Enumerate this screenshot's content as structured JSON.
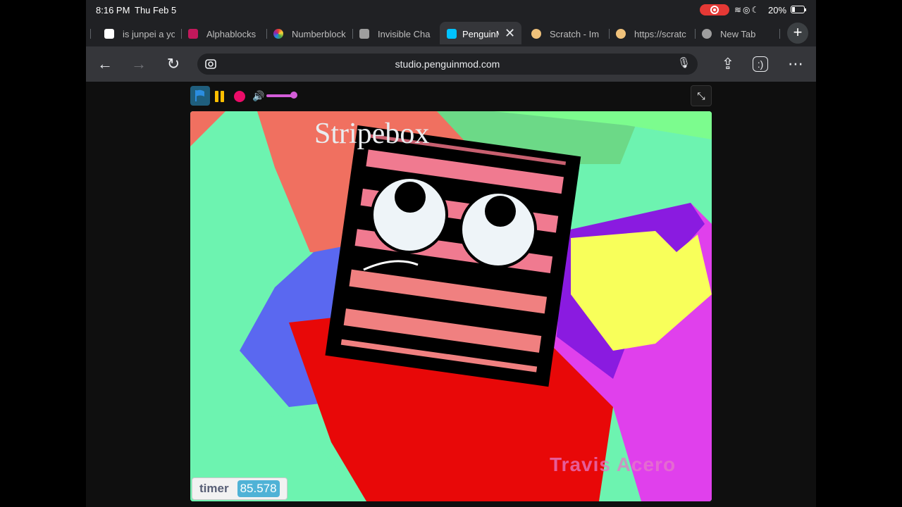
{
  "status_bar": {
    "time": "8:16 PM",
    "date": "Thu Feb 5",
    "battery": "20%"
  },
  "tabs": [
    {
      "title": "is junpei a yo",
      "favicon": "google-icon",
      "color": "#ffffff"
    },
    {
      "title": "Alphablocks",
      "favicon": "alphablocks-icon",
      "color": "#c2185b"
    },
    {
      "title": "Numberblock",
      "favicon": "numberblocks-icon",
      "color": "#7e57c2"
    },
    {
      "title": "Invisible Cha",
      "favicon": "image-icon",
      "color": "#9e9e9e"
    },
    {
      "title": "PenguinM",
      "favicon": "penguinmod-icon",
      "color": "#00c3ff",
      "active": true
    },
    {
      "title": "Scratch - Im",
      "favicon": "scratch-icon",
      "color": "#f0c27b"
    },
    {
      "title": "https://scratc",
      "favicon": "scratch-icon",
      "color": "#f0c27b"
    },
    {
      "title": "New Tab",
      "favicon": "globe-icon",
      "color": "#bdbdbd"
    }
  ],
  "toolbar": {
    "url": "studio.penguinmod.com"
  },
  "stage": {
    "title": "Stripebox",
    "timer_label": "timer",
    "timer_value": "85.578",
    "watermark": "Travis Acero"
  },
  "colors": {
    "flag": "#1f5e7d",
    "pause": "#ffbf00",
    "stop": "#ec0c68",
    "volume": "#d35dd8",
    "monitor_value": "#4fb2d6"
  }
}
